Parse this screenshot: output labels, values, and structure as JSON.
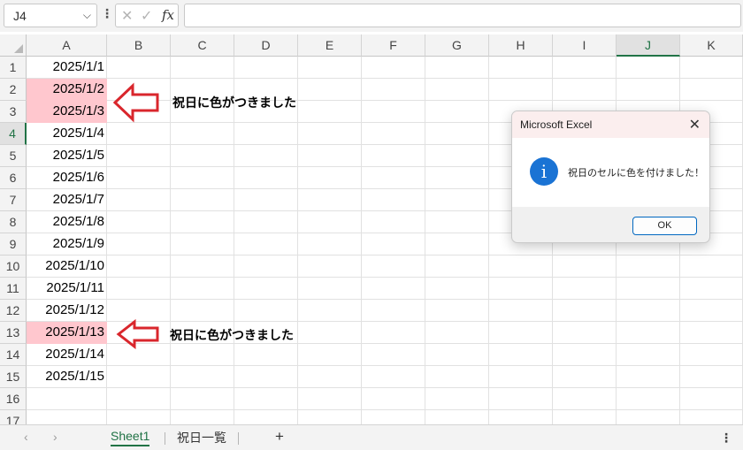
{
  "formula_bar": {
    "name_box": "J4",
    "cancel_glyph": "✕",
    "enter_glyph": "✓",
    "fx_label": "fx",
    "formula": ""
  },
  "columns": [
    "A",
    "B",
    "C",
    "D",
    "E",
    "F",
    "G",
    "H",
    "I",
    "J",
    "K"
  ],
  "selected_column": "J",
  "rows": [
    "1",
    "2",
    "3",
    "4",
    "5",
    "6",
    "7",
    "8",
    "9",
    "10",
    "11",
    "12",
    "13",
    "14",
    "15",
    "16",
    "17"
  ],
  "selected_row": "4",
  "cells": [
    "2025/1/1",
    "2025/1/2",
    "2025/1/3",
    "2025/1/4",
    "2025/1/5",
    "2025/1/6",
    "2025/1/7",
    "2025/1/8",
    "2025/1/9",
    "2025/1/10",
    "2025/1/11",
    "2025/1/12",
    "2025/1/13",
    "2025/1/14",
    "2025/1/15"
  ],
  "highlighted_rows": [
    "2",
    "3",
    "13"
  ],
  "highlight_color": "#ffc7ce",
  "arrow_color": "#d9262c",
  "annotations": [
    "祝日に色がつきました",
    "祝日に色がつきました"
  ],
  "dialog": {
    "title": "Microsoft Excel",
    "message": "祝日のセルに色を付けました！",
    "ok_label": "OK",
    "icon": "info-icon"
  },
  "sheet_tabs": [
    "Sheet1",
    "祝日一覧"
  ],
  "active_tab": "Sheet1",
  "add_sheet_label": "+"
}
